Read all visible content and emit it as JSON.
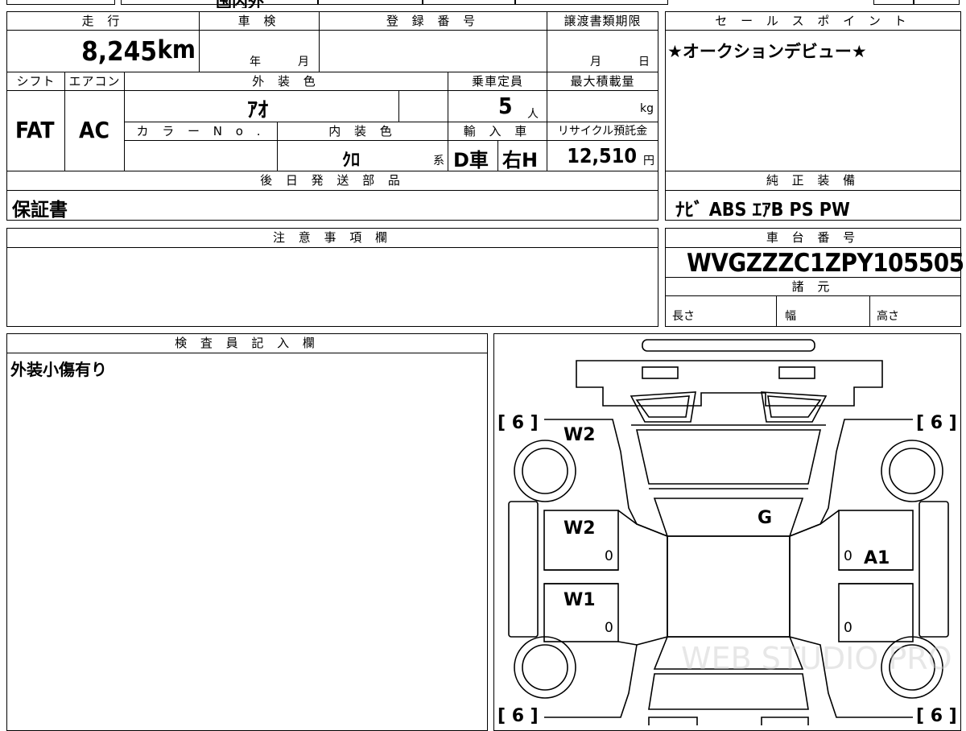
{
  "top_strip": {
    "partial_text": "国内外"
  },
  "mileage": {
    "label": "走 行",
    "value": "8,245",
    "unit": "km"
  },
  "shaken": {
    "label": "車 検",
    "year_unit": "年",
    "month_unit": "月"
  },
  "registration": {
    "label": "登 録 番 号",
    "value": ""
  },
  "transfer_deadline": {
    "label": "譲渡書類期限",
    "month_unit": "月",
    "day_unit": "日"
  },
  "sales_point": {
    "label": "セ ー ル ス ポ イ ン ト",
    "text": "★オークションデビュー★"
  },
  "shift": {
    "label": "シフト",
    "value": "FAT"
  },
  "aircon": {
    "label": "エアコン",
    "value": "AC"
  },
  "exterior_color": {
    "label": "外 装 色",
    "value": "ｱｵ"
  },
  "capacity": {
    "label": "乗車定員",
    "value": "5",
    "unit": "人"
  },
  "max_load": {
    "label": "最大積載量",
    "unit": "kg"
  },
  "color_no": {
    "label": "カ ラ ー N o ."
  },
  "interior_color": {
    "label": "内 装 色",
    "value": "ｸﾛ",
    "suffix": "系"
  },
  "import": {
    "label": "輸 入 車",
    "dealer": "D車",
    "handle": "右H"
  },
  "recycle": {
    "label": "リサイクル預託金",
    "value": "12,510",
    "unit": "円"
  },
  "later_parts": {
    "label": "後 日 発 送 部 品",
    "value": "保証書"
  },
  "genuine_equipment": {
    "label": "純 正 装 備",
    "value": "ﾅﾋﾞ ABS ｴｱB PS PW"
  },
  "notes": {
    "label": "注 意 事 項 欄",
    "value": ""
  },
  "chassis": {
    "label": "車 台 番 号",
    "value": "WVGZZZC1ZPY105505"
  },
  "specs": {
    "label": "諸 元",
    "length": "長さ",
    "width": "幅",
    "height": "高さ"
  },
  "inspector": {
    "label": "検 査 員 記 入 欄",
    "value": "外装小傷有り"
  },
  "diagram": {
    "tread_fl": "[ 6 ]",
    "tread_fr": "[ 6 ]",
    "tread_rl": "[ 6 ]",
    "tread_rr": "[ 6 ]",
    "mark_front_fender_left": "W2",
    "mark_front_door_left": "W2",
    "mark_rear_door_left": "W1",
    "mark_windshield": "G",
    "mark_front_door_right": "A1",
    "zero_1": "0",
    "zero_2": "0",
    "zero_3": "0",
    "zero_4": "0",
    "watermark": "WEB STUDIO PRO"
  }
}
